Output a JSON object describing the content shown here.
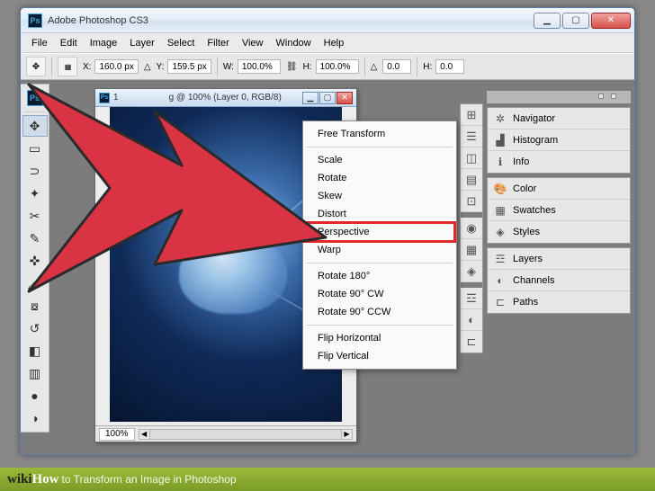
{
  "titlebar": {
    "title": "Adobe Photoshop CS3"
  },
  "menu": {
    "file": "File",
    "edit": "Edit",
    "image": "Image",
    "layer": "Layer",
    "select": "Select",
    "filter": "Filter",
    "view": "View",
    "window": "Window",
    "help": "Help"
  },
  "options": {
    "x_label": "X:",
    "x_val": "160.0 px",
    "y_label": "Y:",
    "y_val": "159.5 px",
    "w_label": "W:",
    "w_val": "100.0%",
    "h_label": "H:",
    "h_val": "100.0%",
    "angle_val": "0.0",
    "horiz_label": "H:",
    "horiz_val": "0.0"
  },
  "doc": {
    "title_prefix": "1",
    "title_suffix": "g @ 100% (Layer 0, RGB/8)",
    "zoom": "100%"
  },
  "context_menu": {
    "free_transform": "Free Transform",
    "scale": "Scale",
    "rotate": "Rotate",
    "skew": "Skew",
    "distort": "Distort",
    "perspective": "Perspective",
    "warp": "Warp",
    "rotate180": "Rotate 180°",
    "rotate90cw": "Rotate 90° CW",
    "rotate90ccw": "Rotate 90° CCW",
    "fliph": "Flip Horizontal",
    "flipv": "Flip Vertical"
  },
  "panels": {
    "navigator": "Navigator",
    "histogram": "Histogram",
    "info": "Info",
    "color": "Color",
    "swatches": "Swatches",
    "styles": "Styles",
    "layers": "Layers",
    "channels": "Channels",
    "paths": "Paths"
  },
  "caption": {
    "brand_prefix": "wiki",
    "brand_suffix": "How",
    "text": " to Transform an Image in Photoshop"
  }
}
